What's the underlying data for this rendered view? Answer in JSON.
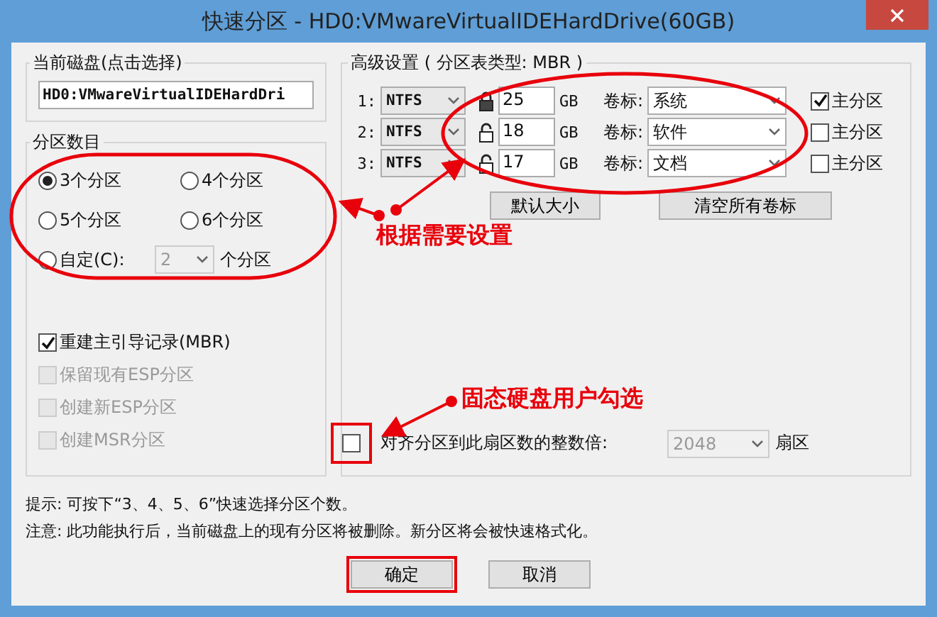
{
  "window": {
    "title": "快速分区 - HD0:VMwareVirtualIDEHardDrive(60GB)"
  },
  "current_disk": {
    "label": "当前磁盘(点击选择)",
    "value": "HD0:VMwareVirtualIDEHardDri"
  },
  "partition_count": {
    "label": "分区数目",
    "options": [
      {
        "label": "3个分区",
        "selected": true
      },
      {
        "label": "4个分区",
        "selected": false
      },
      {
        "label": "5个分区",
        "selected": false
      },
      {
        "label": "6个分区",
        "selected": false
      }
    ],
    "custom": {
      "label": "自定(C):",
      "selected": false,
      "value": "2",
      "suffix": "个分区"
    }
  },
  "options": [
    {
      "label": "重建主引导记录(MBR)",
      "checked": true,
      "disabled": false
    },
    {
      "label": "保留现有ESP分区",
      "checked": false,
      "disabled": true
    },
    {
      "label": "创建新ESP分区",
      "checked": false,
      "disabled": true
    },
    {
      "label": "创建MSR分区",
      "checked": false,
      "disabled": true
    }
  ],
  "advanced": {
    "label": "高级设置 ( 分区表类型: MBR )",
    "rows": [
      {
        "index": "1:",
        "fs": "NTFS",
        "locked": true,
        "size": "25",
        "unit": "GB",
        "volume_label": "卷标:",
        "volume": "系统",
        "primary_label": "主分区",
        "primary": true
      },
      {
        "index": "2:",
        "fs": "NTFS",
        "locked": false,
        "size": "18",
        "unit": "GB",
        "volume_label": "卷标:",
        "volume": "软件",
        "primary_label": "主分区",
        "primary": false
      },
      {
        "index": "3:",
        "fs": "NTFS",
        "locked": false,
        "size": "17",
        "unit": "GB",
        "volume_label": "卷标:",
        "volume": "文档",
        "primary_label": "主分区",
        "primary": false
      }
    ],
    "buttons": [
      "默认大小",
      "清空所有卷标"
    ],
    "align": {
      "label": "对齐分区到此扇区数的整数倍:",
      "checked": false,
      "value": "2048",
      "unit": "扇区"
    }
  },
  "hints": [
    "提示: 可按下“3、4、5、6”快速选择分区个数。",
    "注意: 此功能执行后，当前磁盘上的现有分区将被删除。新分区将会被快速格式化。"
  ],
  "buttons": [
    "确定",
    "取消"
  ],
  "annotations": [
    "根据需要设置",
    "固态硬盘用户勾选"
  ]
}
